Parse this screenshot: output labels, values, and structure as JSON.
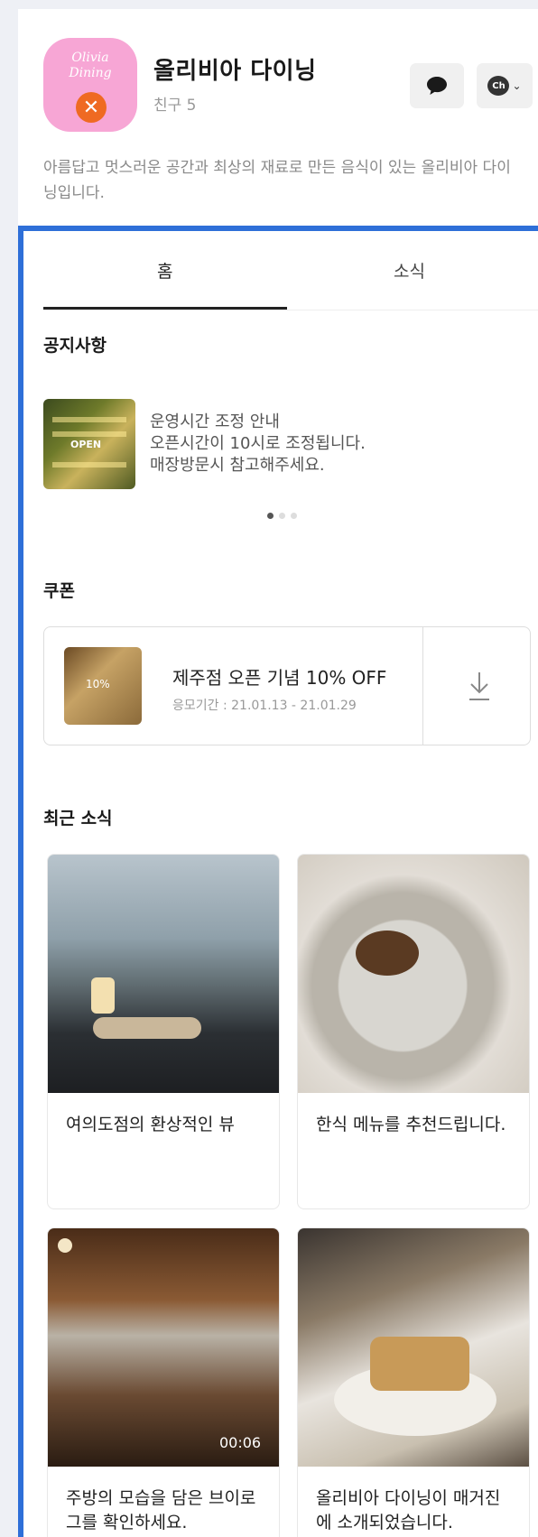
{
  "profile": {
    "logo_text": "Olivia\nDining",
    "name": "올리비아 다이닝",
    "friends": "친구 5",
    "description": "아름답고 멋스러운 공간과 최상의 재료로 만든 음식이 있는 올리비아 다이닝입니다.",
    "channel_label": "Ch"
  },
  "tabs": [
    {
      "label": "홈",
      "active": true
    },
    {
      "label": "소식",
      "active": false
    }
  ],
  "notice": {
    "title": "공지사항",
    "image_label": "OPEN",
    "lines": [
      "운영시간 조정 안내",
      "오픈시간이 10시로 조정됩니다.",
      "매장방문시 참고해주세요."
    ],
    "page_count": 3,
    "current_page": 1
  },
  "coupon": {
    "section_title": "쿠폰",
    "image_label": "10%",
    "title": "제주점 오픈 기념 10% OFF",
    "period": "응모기간 : 21.01.13 - 21.01.29"
  },
  "news": {
    "section_title": "최근 소식",
    "items": [
      {
        "caption": "여의도점의 환상적인 뷰"
      },
      {
        "caption": "한식 메뉴를 추천드립니다."
      },
      {
        "caption": "주방의 모습을 담은 브이로그를 확인하세요.",
        "video_duration": "00:06"
      },
      {
        "caption": "올리비아 다이닝이 매거진에 소개되었습니다."
      }
    ]
  },
  "colors": {
    "accent": "#2e6fd8",
    "logo_bg": "#f7a6d5",
    "logo_badge": "#ef6a22"
  },
  "icons": {
    "chat": "speech-bubble-icon",
    "channel": "channel-icon",
    "download": "download-icon",
    "logo_badge": "fork-spoon-icon"
  }
}
